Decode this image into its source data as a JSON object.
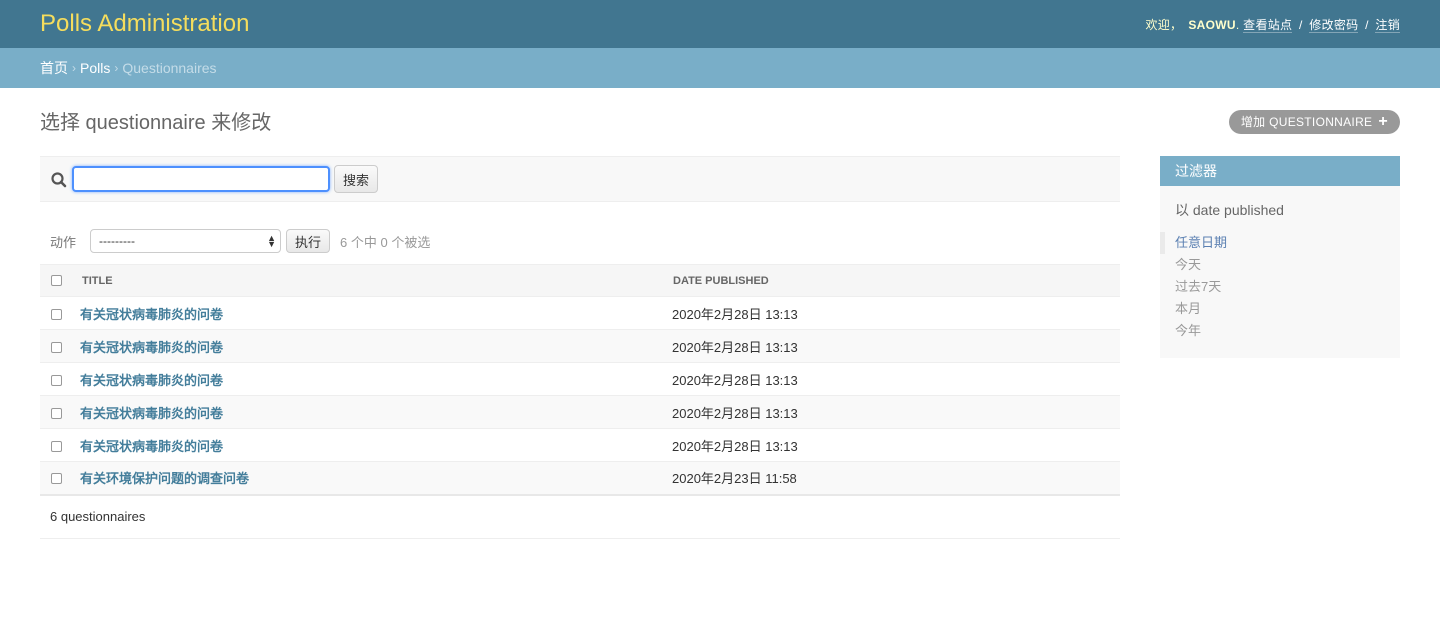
{
  "header": {
    "site_name": "Polls Administration",
    "welcome": "欢迎，",
    "username": "SAOWU",
    "username_suffix": ".",
    "links": [
      "查看站点",
      "修改密码",
      "注销"
    ],
    "separator": "/"
  },
  "breadcrumbs": {
    "items": [
      "首页",
      "Polls",
      "Questionnaires"
    ],
    "separator": "›"
  },
  "page": {
    "title": "选择 questionnaire 来修改",
    "add_button": "增加 QUESTIONNAIRE",
    "add_icon": "plus-icon"
  },
  "search": {
    "icon": "search-icon",
    "value": "",
    "placeholder": "",
    "button": "搜索"
  },
  "actions": {
    "label": "动作",
    "selected_option": "---------",
    "go_button": "执行",
    "counter": "6 个中 0 个被选"
  },
  "table": {
    "columns": [
      "TITLE",
      "DATE PUBLISHED"
    ],
    "rows": [
      {
        "title": "有关冠状病毒肺炎的问卷",
        "date": "2020年2月28日 13:13"
      },
      {
        "title": "有关冠状病毒肺炎的问卷",
        "date": "2020年2月28日 13:13"
      },
      {
        "title": "有关冠状病毒肺炎的问卷",
        "date": "2020年2月28日 13:13"
      },
      {
        "title": "有关冠状病毒肺炎的问卷",
        "date": "2020年2月28日 13:13"
      },
      {
        "title": "有关冠状病毒肺炎的问卷",
        "date": "2020年2月28日 13:13"
      },
      {
        "title": "有关环境保护问题的调查问卷",
        "date": "2020年2月23日 11:58"
      }
    ]
  },
  "paginator": {
    "text": "6 questionnaires"
  },
  "filter": {
    "title": "过滤器",
    "subtitle": "以 date published",
    "options": [
      "任意日期",
      "今天",
      "过去7天",
      "本月",
      "今年"
    ],
    "selected_index": 0
  },
  "colors": {
    "header_bg": "#417690",
    "site_name": "#f5dd5d",
    "breadcrumb_bg": "#79aec8",
    "link": "#447e9b",
    "filter_selected": "#5b80b2",
    "add_button_bg": "#999999"
  }
}
